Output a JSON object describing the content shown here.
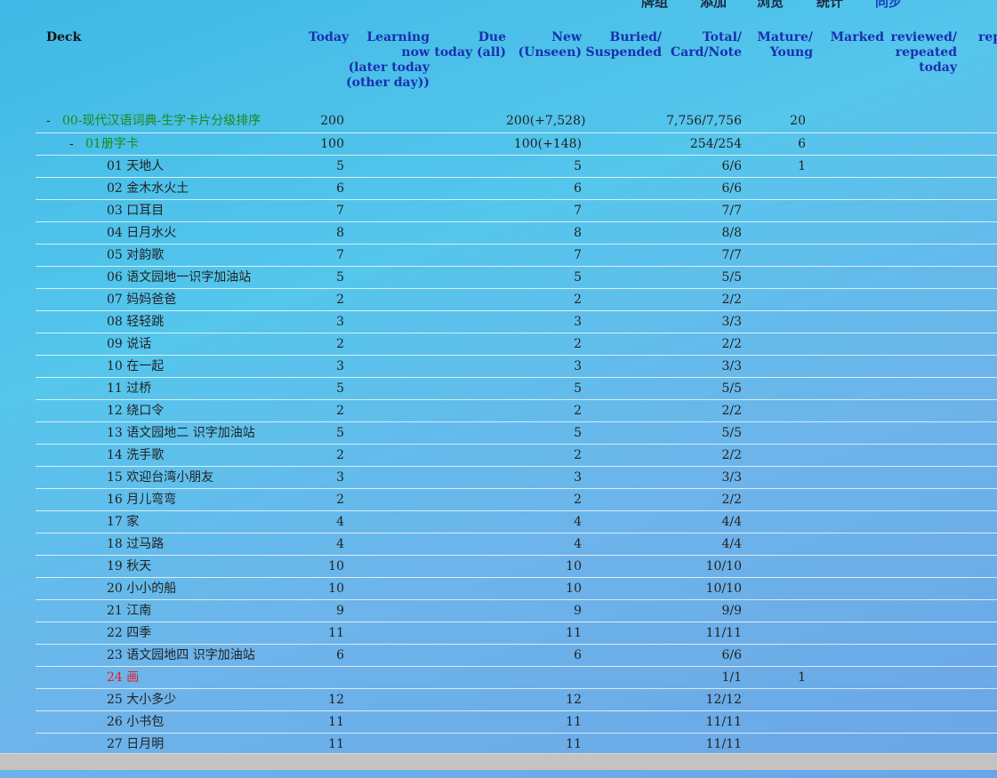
{
  "topnav": {
    "decks": "牌组",
    "add": "添加",
    "browse": "浏览",
    "stats": "统计",
    "sync": "同步"
  },
  "headers": {
    "deck": "Deck",
    "today": "Today",
    "learning": [
      "Learning",
      "now",
      "(later today",
      "(other day))"
    ],
    "due": [
      "Due",
      "today (all)"
    ],
    "new": [
      "New",
      "(Unseen)"
    ],
    "buried": [
      "Buried/",
      "Suspended"
    ],
    "total": [
      "Total/",
      "Card/Note"
    ],
    "mature": [
      "Mature/",
      "Young"
    ],
    "marked": "Marked",
    "reviewed": [
      "reviewed/",
      "repeated",
      "today"
    ],
    "rep": "rep"
  },
  "rows": [
    {
      "name": "00-现代汉语词典-生字卡片分级排序",
      "level": 0,
      "collapse": "-",
      "style": "green",
      "today": "200",
      "new": "200(+7,528)",
      "total": "7,756/7,756",
      "mature": "20"
    },
    {
      "name": "01册字卡",
      "level": 1,
      "collapse": "-",
      "style": "green",
      "today": "100",
      "new": "100(+148)",
      "total": "254/254",
      "mature": "6"
    },
    {
      "name": "01 天地人",
      "level": 2,
      "today": "5",
      "new": "5",
      "total": "6/6",
      "mature": "1"
    },
    {
      "name": "02 金木水火土",
      "level": 2,
      "today": "6",
      "new": "6",
      "total": "6/6"
    },
    {
      "name": "03 口耳目",
      "level": 2,
      "today": "7",
      "new": "7",
      "total": "7/7"
    },
    {
      "name": "04 日月水火",
      "level": 2,
      "today": "8",
      "new": "8",
      "total": "8/8"
    },
    {
      "name": "05 对韵歌",
      "level": 2,
      "today": "7",
      "new": "7",
      "total": "7/7"
    },
    {
      "name": "06 语文园地一识字加油站",
      "level": 2,
      "today": "5",
      "new": "5",
      "total": "5/5"
    },
    {
      "name": "07 妈妈爸爸",
      "level": 2,
      "today": "2",
      "new": "2",
      "total": "2/2"
    },
    {
      "name": "08 轻轻跳",
      "level": 2,
      "today": "3",
      "new": "3",
      "total": "3/3"
    },
    {
      "name": "09 说话",
      "level": 2,
      "today": "2",
      "new": "2",
      "total": "2/2"
    },
    {
      "name": "10 在一起",
      "level": 2,
      "today": "3",
      "new": "3",
      "total": "3/3"
    },
    {
      "name": "11 过桥",
      "level": 2,
      "today": "5",
      "new": "5",
      "total": "5/5"
    },
    {
      "name": "12 绕口令",
      "level": 2,
      "today": "2",
      "new": "2",
      "total": "2/2"
    },
    {
      "name": "13 语文园地二 识字加油站",
      "level": 2,
      "today": "5",
      "new": "5",
      "total": "5/5"
    },
    {
      "name": "14 洗手歌",
      "level": 2,
      "today": "2",
      "new": "2",
      "total": "2/2"
    },
    {
      "name": "15 欢迎台湾小朋友",
      "level": 2,
      "today": "3",
      "new": "3",
      "total": "3/3"
    },
    {
      "name": "16 月儿弯弯",
      "level": 2,
      "today": "2",
      "new": "2",
      "total": "2/2"
    },
    {
      "name": "17 家",
      "level": 2,
      "today": "4",
      "new": "4",
      "total": "4/4"
    },
    {
      "name": "18 过马路",
      "level": 2,
      "today": "4",
      "new": "4",
      "total": "4/4"
    },
    {
      "name": "19 秋天",
      "level": 2,
      "today": "10",
      "new": "10",
      "total": "10/10"
    },
    {
      "name": "20 小小的船",
      "level": 2,
      "today": "10",
      "new": "10",
      "total": "10/10"
    },
    {
      "name": "21 江南",
      "level": 2,
      "today": "9",
      "new": "9",
      "total": "9/9"
    },
    {
      "name": "22 四季",
      "level": 2,
      "today": "11",
      "new": "11",
      "total": "11/11"
    },
    {
      "name": "23 语文园地四 识字加油站",
      "level": 2,
      "today": "6",
      "new": "6",
      "total": "6/6"
    },
    {
      "name": "24 画",
      "level": 2,
      "style": "red",
      "today": "",
      "new": "",
      "total": "1/1",
      "mature": "1"
    },
    {
      "name": "25 大小多少",
      "level": 2,
      "today": "12",
      "new": "12",
      "total": "12/12"
    },
    {
      "name": "26 小书包",
      "level": 2,
      "today": "11",
      "new": "11",
      "total": "11/11"
    },
    {
      "name": "27 日月明",
      "level": 2,
      "today": "11",
      "new": "11",
      "total": "11/11"
    }
  ]
}
